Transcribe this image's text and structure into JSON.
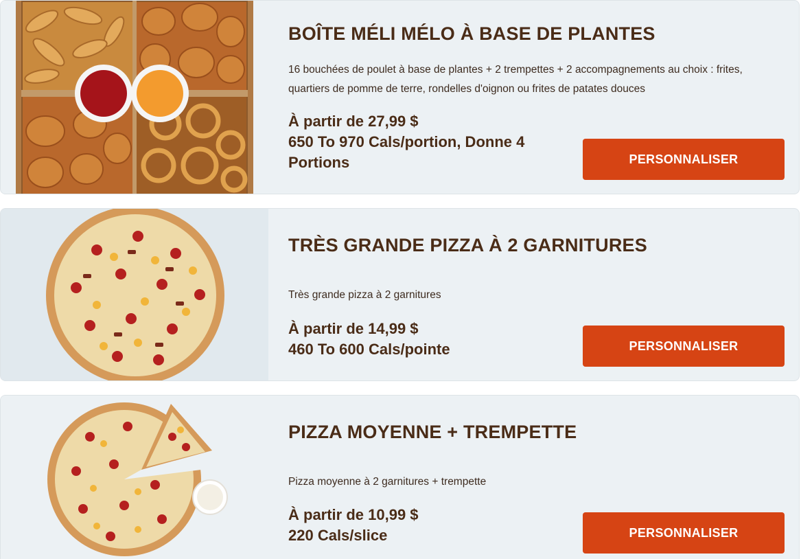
{
  "colors": {
    "card_background": "#ecf1f4",
    "title_text": "#4a2c17",
    "button_background": "#d64414",
    "button_text": "#ffffff"
  },
  "products": [
    {
      "title": "BOÎTE MÉLI MÉLO À BASE DE PLANTES",
      "description": "16 bouchées de poulet à base de plantes + 2 trempettes + 2 accompagnements au choix : frites, quartiers de pomme de terre, rondelles d'oignon ou frites de patates douces",
      "price": "À partir de 27,99 $",
      "calories": "650 To 970 Cals/portion, Donne 4 Portions",
      "button_label": "PERSONNALISER",
      "image": "plant-based-combo-box-image"
    },
    {
      "title": "TRÈS GRANDE PIZZA À 2 GARNITURES",
      "description": "Très grande pizza à 2 garnitures",
      "price": "À partir de 14,99 $",
      "calories": "460 To 600 Cals/pointe",
      "button_label": "PERSONNALISER",
      "image": "extra-large-pizza-image"
    },
    {
      "title": "PIZZA MOYENNE + TREMPETTE",
      "description": "Pizza moyenne à 2 garnitures + trempette",
      "price": "À partir de 10,99 $",
      "calories": "220 Cals/slice",
      "button_label": "PERSONNALISER",
      "image": "medium-pizza-with-dip-image"
    }
  ]
}
